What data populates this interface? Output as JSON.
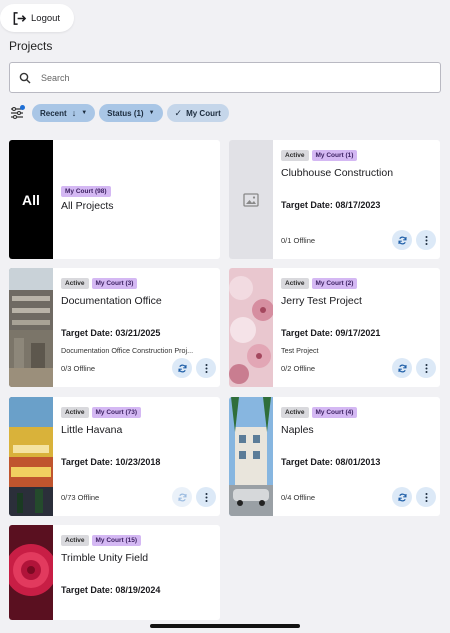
{
  "header": {
    "logout_label": "Logout",
    "title": "Projects"
  },
  "search": {
    "placeholder": "Search"
  },
  "filters": {
    "recent_label": "Recent",
    "status_label": "Status (1)",
    "mycourt_label": "My Court"
  },
  "all_card": {
    "thumb_label": "All",
    "badge": "My Court (98)",
    "name": "All Projects"
  },
  "projects": [
    {
      "status": "Active",
      "court": "My Court (1)",
      "name": "Clubhouse Construction",
      "target": "Target Date: 08/17/2023",
      "description": "",
      "offline": "0/1 Offline"
    },
    {
      "status": "Active",
      "court": "My Court (3)",
      "name": "Documentation Office",
      "target": "Target Date: 03/21/2025",
      "description": "Documentation Office Construction Proj...",
      "offline": "0/3 Offline"
    },
    {
      "status": "Active",
      "court": "My Court (2)",
      "name": "Jerry Test Project",
      "target": "Target Date: 09/17/2021",
      "description": "Test Project",
      "offline": "0/2 Offline"
    },
    {
      "status": "Active",
      "court": "My Court (73)",
      "name": "Little Havana",
      "target": "Target Date: 10/23/2018",
      "description": "",
      "offline": "0/73 Offline"
    },
    {
      "status": "Active",
      "court": "My Court (4)",
      "name": "Naples",
      "target": "Target Date: 08/01/2013",
      "description": "",
      "offline": "0/4 Offline"
    },
    {
      "status": "Active",
      "court": "My Court (15)",
      "name": "Trimble Unity Field",
      "target": "Target Date: 08/19/2024",
      "description": "",
      "offline": ""
    }
  ],
  "colors": {
    "chip": "#a9c6e6",
    "court_badge": "#d4b8f3",
    "active_badge": "#d9d9dd",
    "action_button": "#dce9f7",
    "background": "#f1f1f4"
  },
  "icons": {
    "logout": "logout-icon",
    "search": "search-icon",
    "filter": "filter-settings-icon",
    "sync": "sync-icon",
    "more": "more-vertical-icon",
    "placeholder": "image-placeholder-icon"
  }
}
